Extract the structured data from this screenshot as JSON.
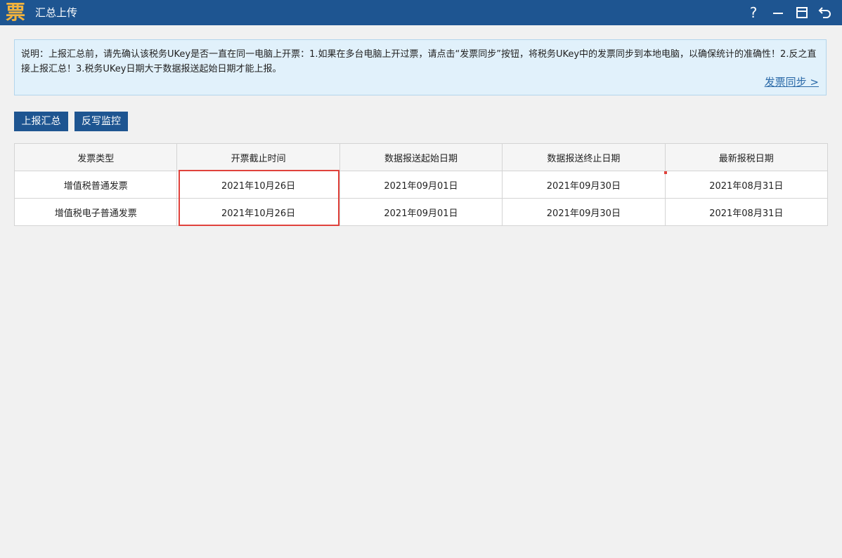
{
  "window": {
    "logo_char": "票",
    "title": "汇总上传",
    "help_label": "?"
  },
  "notice": {
    "text": "说明：上报汇总前，请先确认该税务UKey是否一直在同一电脑上开票：1.如果在多台电脑上开过票，请点击“发票同步”按钮，将税务UKey中的发票同步到本地电脑，以确保统计的准确性！2.反之直接上报汇总！3.税务UKey日期大于数据报送起始日期才能上报。",
    "sync_link": "发票同步 >"
  },
  "toolbar": {
    "report_label": "上报汇总",
    "writeback_label": "反写监控"
  },
  "table": {
    "headers": [
      "发票类型",
      "开票截止时间",
      "数据报送起始日期",
      "数据报送终止日期",
      "最新报税日期"
    ],
    "rows": [
      [
        "增值税普通发票",
        "2021年10月26日",
        "2021年09月01日",
        "2021年09月30日",
        "2021年08月31日"
      ],
      [
        "增值税电子普通发票",
        "2021年10月26日",
        "2021年09月01日",
        "2021年09月30日",
        "2021年08月31日"
      ]
    ]
  },
  "colors": {
    "titlebar": "#1e5591",
    "highlight": "#e0423c",
    "notice_bg": "#e1f1fb"
  }
}
